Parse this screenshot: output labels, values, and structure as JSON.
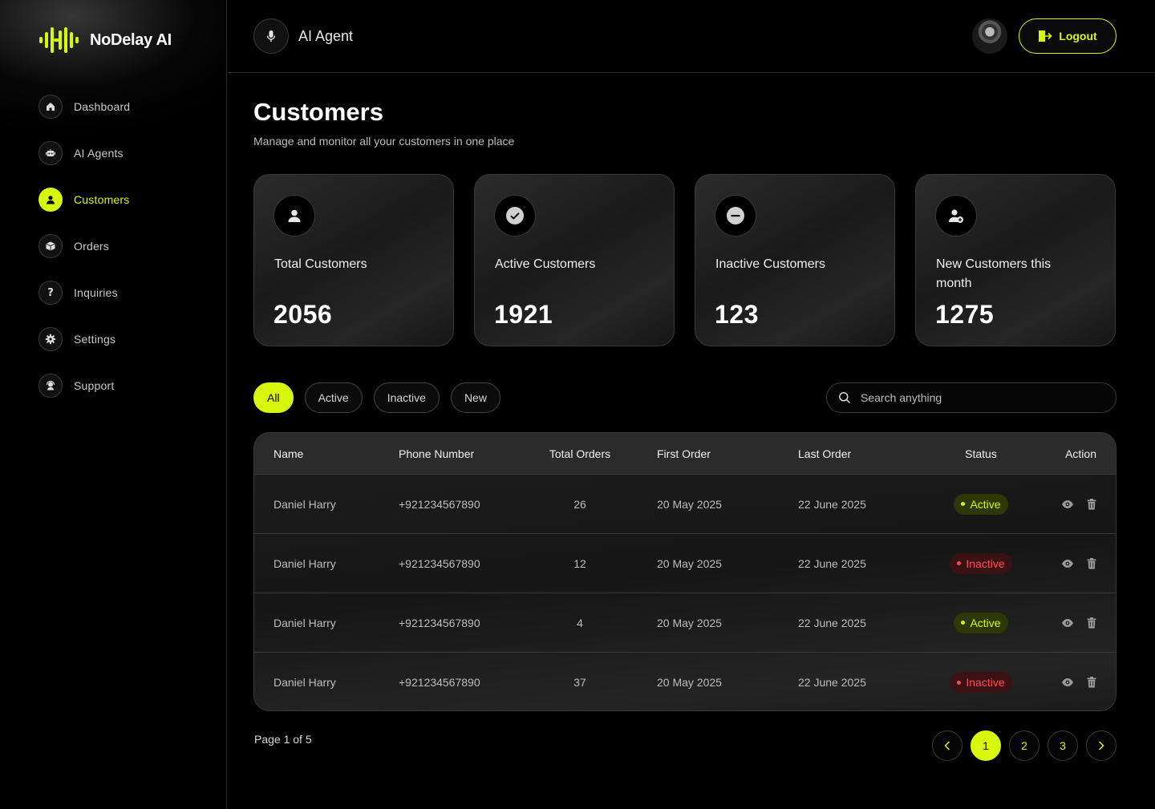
{
  "brand": {
    "name": "NoDelay AI",
    "accent": "#d7f70c"
  },
  "sidebar": {
    "items": [
      {
        "label": "Dashboard",
        "icon": "home-icon",
        "active": false
      },
      {
        "label": "AI Agents",
        "icon": "robot-icon",
        "active": false
      },
      {
        "label": "Customers",
        "icon": "user-icon",
        "active": true
      },
      {
        "label": "Orders",
        "icon": "box-icon",
        "active": false
      },
      {
        "label": "Inquiries",
        "icon": "question-icon",
        "active": false
      },
      {
        "label": "Settings",
        "icon": "gear-icon",
        "active": false
      },
      {
        "label": "Support",
        "icon": "headset-icon",
        "active": false
      }
    ]
  },
  "header": {
    "title": "AI Agent",
    "logout_label": "Logout"
  },
  "page": {
    "title": "Customers",
    "subtitle": "Manage and monitor all your customers in one place"
  },
  "stats": [
    {
      "label": "Total Customers",
      "value": "2056",
      "icon": "user-icon"
    },
    {
      "label": "Active Customers",
      "value": "1921",
      "icon": "check-circle-icon"
    },
    {
      "label": "Inactive Customers",
      "value": "123",
      "icon": "minus-circle-icon"
    },
    {
      "label": "New Customers this month",
      "value": "1275",
      "icon": "user-add-icon"
    }
  ],
  "filters": {
    "items": [
      "All",
      "Active",
      "Inactive",
      "New"
    ],
    "selected": "All"
  },
  "search": {
    "placeholder": "Search anything",
    "value": ""
  },
  "table": {
    "columns": [
      "Name",
      "Phone Number",
      "Total Orders",
      "First Order",
      "Last Order",
      "Status",
      "Action"
    ],
    "rows": [
      {
        "name": "Daniel Harry",
        "phone": "+921234567890",
        "orders": "26",
        "first": "20 May 2025",
        "last": "22 June 2025",
        "status": "Active"
      },
      {
        "name": "Daniel Harry",
        "phone": "+921234567890",
        "orders": "12",
        "first": "20 May 2025",
        "last": "22 June 2025",
        "status": "Inactive"
      },
      {
        "name": "Daniel Harry",
        "phone": "+921234567890",
        "orders": "4",
        "first": "20 May 2025",
        "last": "22 June 2025",
        "status": "Active"
      },
      {
        "name": "Daniel Harry",
        "phone": "+921234567890",
        "orders": "37",
        "first": "20 May 2025",
        "last": "22 June 2025",
        "status": "Inactive"
      }
    ]
  },
  "pagination": {
    "info": "Page 1 of 5",
    "pages": [
      "1",
      "2",
      "3"
    ],
    "current": "1"
  },
  "colors": {
    "active": "#d7f70c",
    "inactive": "#ff4d58"
  }
}
